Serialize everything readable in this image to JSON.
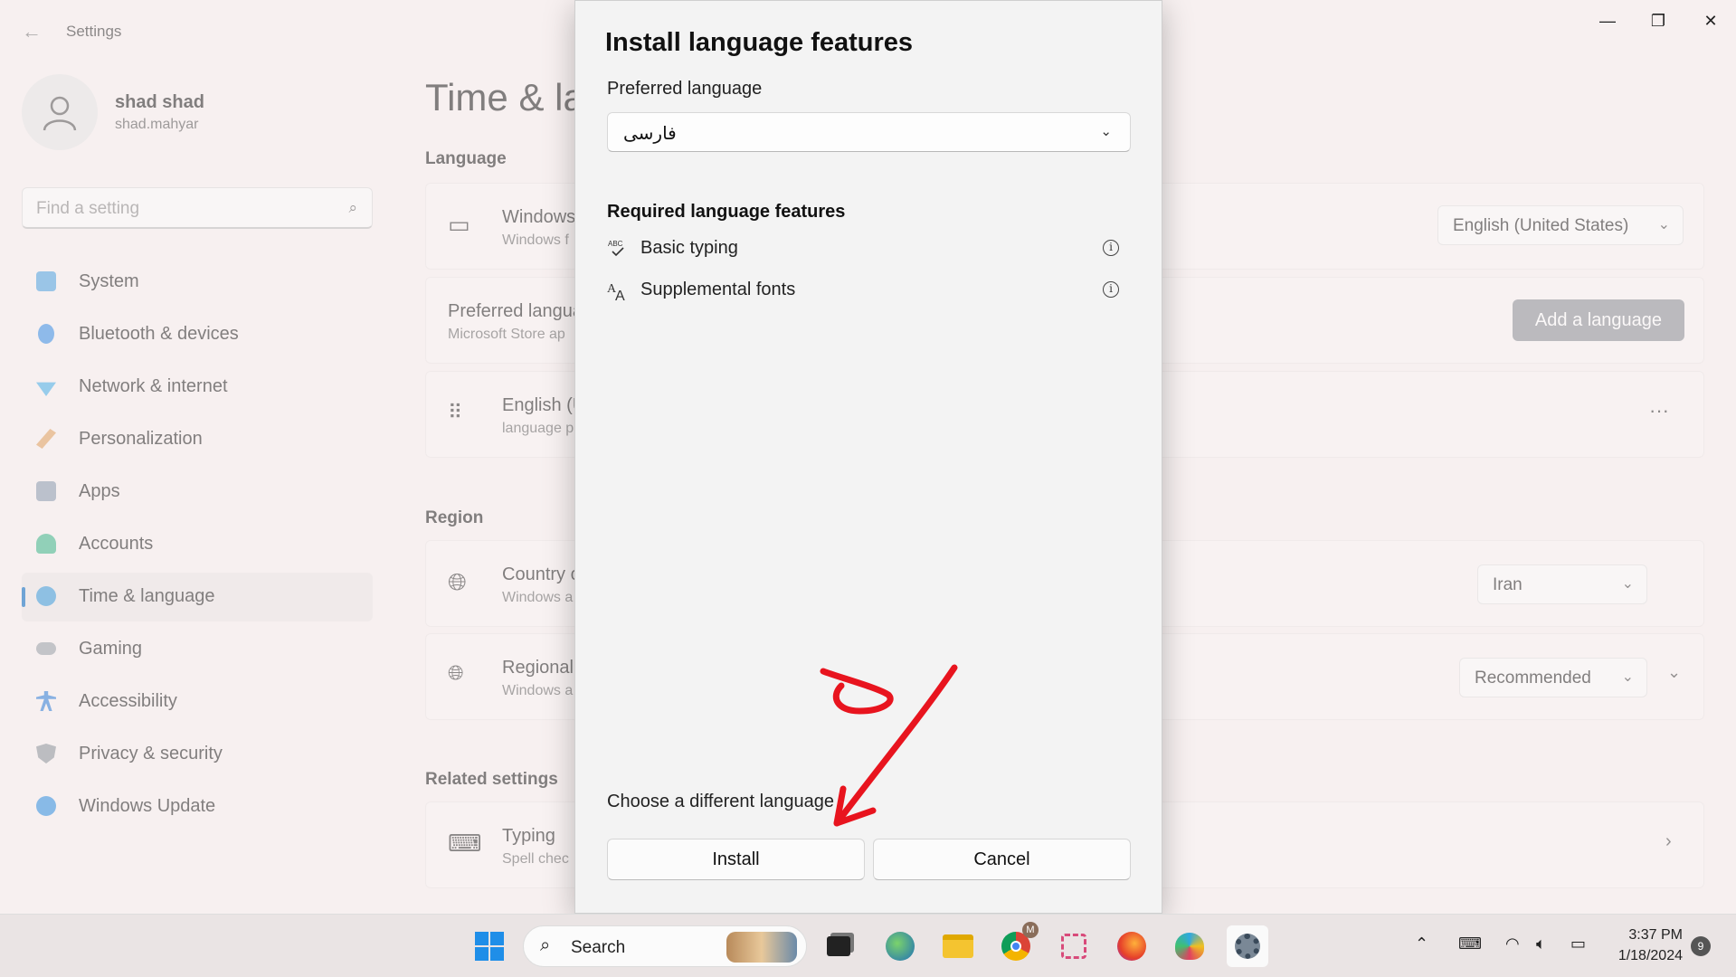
{
  "window": {
    "title": "Settings",
    "controls": {
      "minimize": "—",
      "maximize": "❐",
      "close": "✕"
    }
  },
  "user": {
    "name": "shad shad",
    "email": "shad.mahyar"
  },
  "search": {
    "placeholder": "Find a setting"
  },
  "sidebar": {
    "items": [
      {
        "label": "System",
        "color": "#4fa3e0"
      },
      {
        "label": "Bluetooth & devices",
        "color": "#3a8ee6"
      },
      {
        "label": "Network & internet",
        "color": "#4ab0e8"
      },
      {
        "label": "Personalization",
        "color": "#e0a060"
      },
      {
        "label": "Apps",
        "color": "#8a9bb0"
      },
      {
        "label": "Accounts",
        "color": "#3fb68b"
      },
      {
        "label": "Time & language",
        "color": "#3a9ad9",
        "active": true
      },
      {
        "label": "Gaming",
        "color": "#9aa0a8"
      },
      {
        "label": "Accessibility",
        "color": "#2f7fd8"
      },
      {
        "label": "Privacy & security",
        "color": "#8d949c"
      },
      {
        "label": "Windows Update",
        "color": "#2f8ee0"
      }
    ]
  },
  "main": {
    "title": "Time & la",
    "language_header": "Language",
    "display_lang": {
      "title": "Windows",
      "subtitle": "Windows f",
      "value": "English (United States)"
    },
    "preferred": {
      "title": "Preferred langua",
      "subtitle": "Microsoft Store ap",
      "button": "Add a language"
    },
    "english": {
      "title": "English (U",
      "subtitle": "language p",
      "more": "···"
    },
    "region_header": "Region",
    "country": {
      "title": "Country c",
      "subtitle": "Windows a",
      "value": "Iran"
    },
    "regional": {
      "title": "Regional",
      "subtitle": "Windows a",
      "value": "Recommended"
    },
    "related_header": "Related settings",
    "typing": {
      "title": "Typing",
      "subtitle": "Spell chec"
    }
  },
  "dialog": {
    "title": "Install language features",
    "preferred_label": "Preferred language",
    "preferred_value": "فارسی",
    "required_header": "Required language features",
    "features": [
      {
        "icon": "ABC✓",
        "label": "Basic typing"
      },
      {
        "icon": "A̸A",
        "label": "Supplemental fonts"
      }
    ],
    "choose_link": "Choose a different language",
    "install": "Install",
    "cancel": "Cancel"
  },
  "taskbar": {
    "search_label": "Search",
    "time": "3:37 PM",
    "date": "1/18/2024",
    "notifications": "9",
    "chrome_badge": "M"
  },
  "colors": {
    "accent": "#0067c0",
    "annotation": "#e8141e"
  }
}
